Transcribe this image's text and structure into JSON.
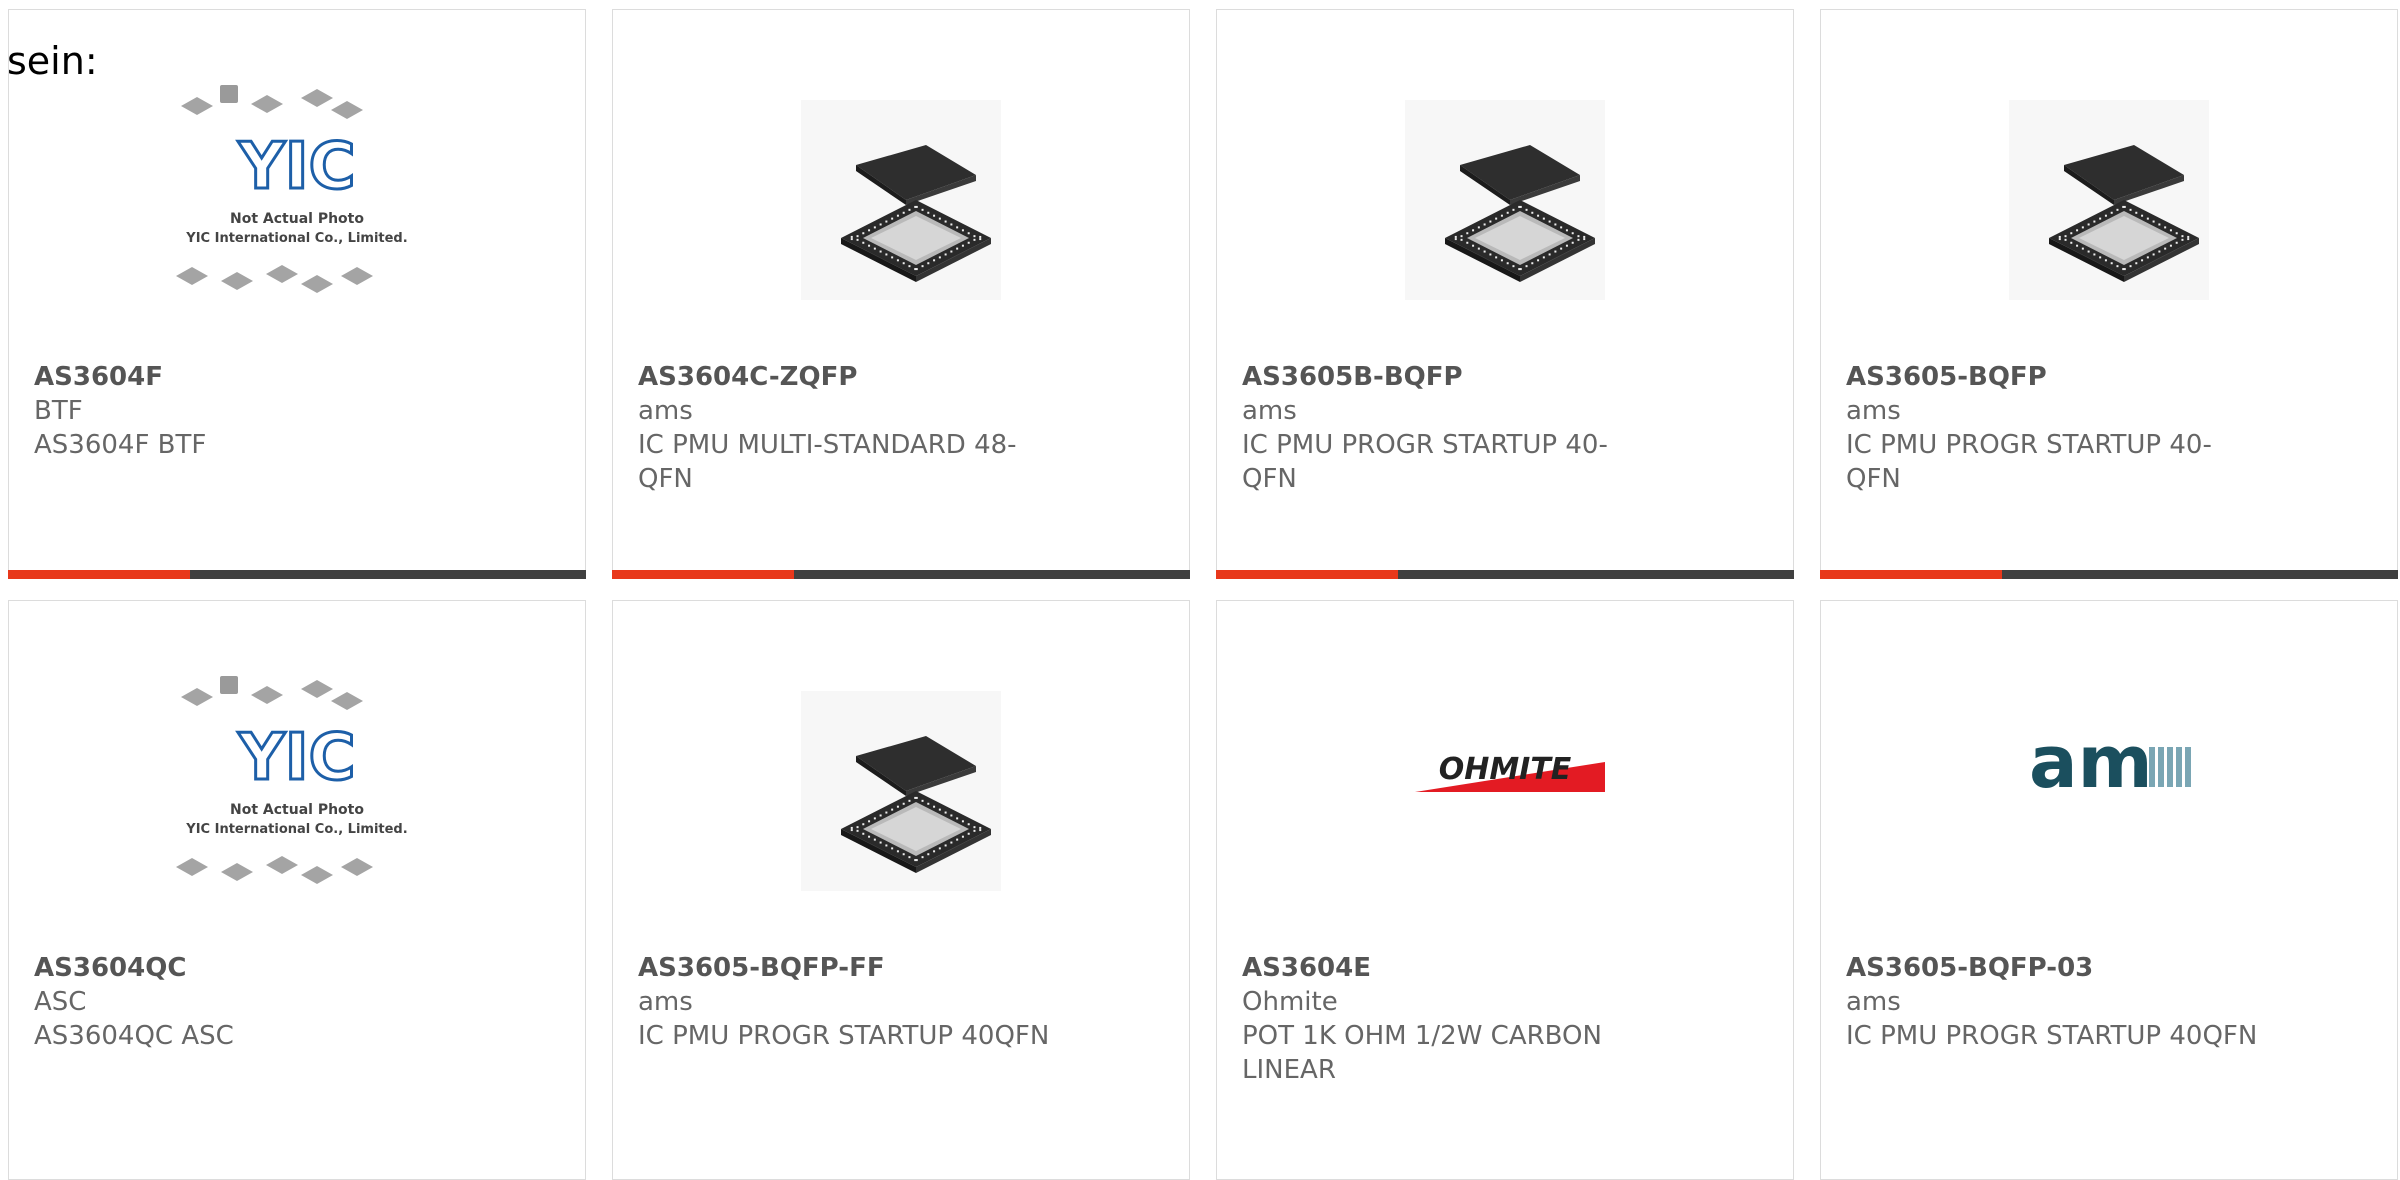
{
  "intro_text": "sein:",
  "placeholder": {
    "brand": "YIC",
    "line1": "Not Actual Photo",
    "line2": "YIC International Co., Limited."
  },
  "ohmite_logo_text": "OHMITE",
  "ams_logo_text": "am",
  "colors": {
    "accent": "#e8381b",
    "bar": "#404040",
    "text": "#666666",
    "yic_blue": "#1d5fa8",
    "ams_teal": "#1b4f5e",
    "ohmite_red": "#e31b23"
  },
  "products": [
    {
      "part": "AS3604F",
      "maker": "BTF",
      "desc": "AS3604F BTF",
      "image": "placeholder",
      "bar": true
    },
    {
      "part": "AS3604C-ZQFP",
      "maker": "ams",
      "desc": "IC PMU MULTI-STANDARD 48-QFN",
      "image": "qfn-chip",
      "bar": true
    },
    {
      "part": "AS3605B-BQFP",
      "maker": "ams",
      "desc": "IC PMU PROGR STARTUP 40-QFN",
      "image": "qfn-chip",
      "bar": true
    },
    {
      "part": "AS3605-BQFP",
      "maker": "ams",
      "desc": "IC PMU PROGR STARTUP 40-QFN",
      "image": "qfn-chip",
      "bar": true
    },
    {
      "part": "AS3604QC",
      "maker": "ASC",
      "desc": "AS3604QC ASC",
      "image": "placeholder",
      "bar": false
    },
    {
      "part": "AS3605-BQFP-FF",
      "maker": "ams",
      "desc": "IC PMU PROGR STARTUP 40QFN",
      "image": "qfn-chip",
      "bar": false
    },
    {
      "part": "AS3604E",
      "maker": "Ohmite",
      "desc": "POT 1K OHM 1/2W CARBON LINEAR",
      "image": "ohmite-logo",
      "bar": false
    },
    {
      "part": "AS3605-BQFP-03",
      "maker": "ams",
      "desc": "IC PMU PROGR STARTUP 40QFN",
      "image": "ams-logo",
      "bar": false
    }
  ]
}
